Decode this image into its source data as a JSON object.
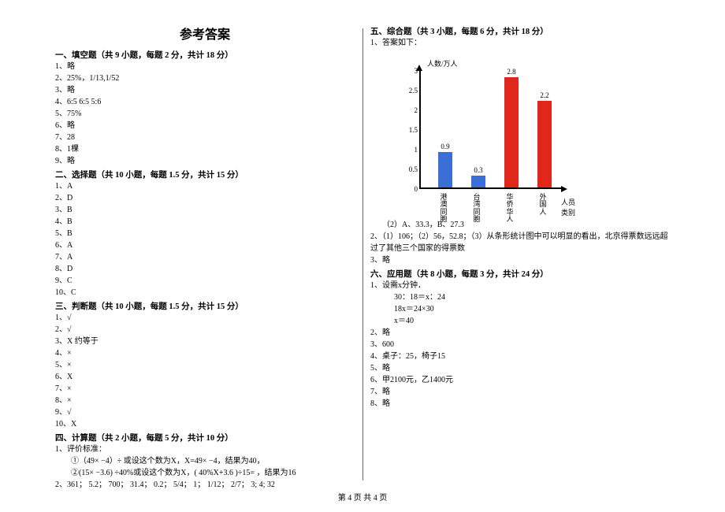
{
  "title": "参考答案",
  "footer": "第 4 页 共 4 页",
  "left": {
    "s1": {
      "head": "一、填空题（共 9 小题，每题 2 分，共计 18 分）",
      "items": [
        "1、略",
        "2、25%，1/13,1/52",
        "3、略",
        "4、6:5   6:5   5:6",
        "5、75%",
        "6、略",
        "7、28",
        "8、1棵",
        "9、略"
      ]
    },
    "s2": {
      "head": "二、选择题（共 10 小题，每题 1.5 分，共计 15 分）",
      "items": [
        "1、A",
        "2、D",
        "3、B",
        "4、B",
        "5、B",
        "6、A",
        "7、A",
        "8、D",
        "9、C",
        "10、C"
      ]
    },
    "s3": {
      "head": "三、判断题（共 10 小题，每题 1.5 分，共计 15 分）",
      "items": [
        "1、√",
        "2、√",
        "3、X 约等于",
        "4、×",
        "5、×",
        "6、X",
        "7、×",
        "8、×",
        "9、√",
        "10、X"
      ]
    },
    "s4": {
      "head": "四、计算题（共 2 小题，每题 5 分，共计 10 分）",
      "items": [
        "1、评价标准：",
        "　　①（49× −4）÷ 或设这个数为X，X=49× −4，结果为40，",
        "　　②(15× −3.6) ÷40%或设这个数为X，( 40%X+3.6 )÷15=  ，结果为16",
        "2、361； 5.2； 700； 31.4； 0.2； 5/4； 1； 1/12； 2/7； 3; 4; 32"
      ]
    }
  },
  "right": {
    "s5": {
      "head": "五、综合题（共 3 小题，每题 6 分，共计 18 分）",
      "pre": "1、答案如下：",
      "after": "　　（2）A、33.3，B、27.3",
      "items": [
        "2、（1）106；（2）56，52.8；（3）从条形统计图中可以明显的看出，北京得票数远远超过了其他三个国家的得票数",
        "3、略"
      ]
    },
    "s6": {
      "head": "六、应用题（共 8 小题，每题 3 分，共计 24 分）",
      "items": [
        "1、设需x分钟．",
        "30：18＝x：24",
        "18x＝24×30",
        "x＝40",
        "2、略",
        "3、600",
        "4、桌子：25，椅子15",
        "5、略",
        "6、甲2100元，乙1400元",
        "7、略",
        "8、略"
      ]
    }
  },
  "chart_data": {
    "type": "bar",
    "title": "",
    "ylabel": "人数/万人",
    "xlabel": "人员类别",
    "categories": [
      "港澳同胞",
      "台湾同胞",
      "华侨华人",
      "外国人"
    ],
    "values": [
      0.9,
      0.3,
      2.8,
      2.2
    ],
    "value_labels": [
      "0.9",
      "0.3",
      "2.8",
      "2.2"
    ],
    "colors": [
      "#3b6fd6",
      "#3b6fd6",
      "#e1261c",
      "#e1261c"
    ],
    "yticks": [
      0,
      0.5,
      1,
      1.5,
      2,
      2.5,
      3
    ],
    "ylim": [
      0,
      3
    ]
  }
}
